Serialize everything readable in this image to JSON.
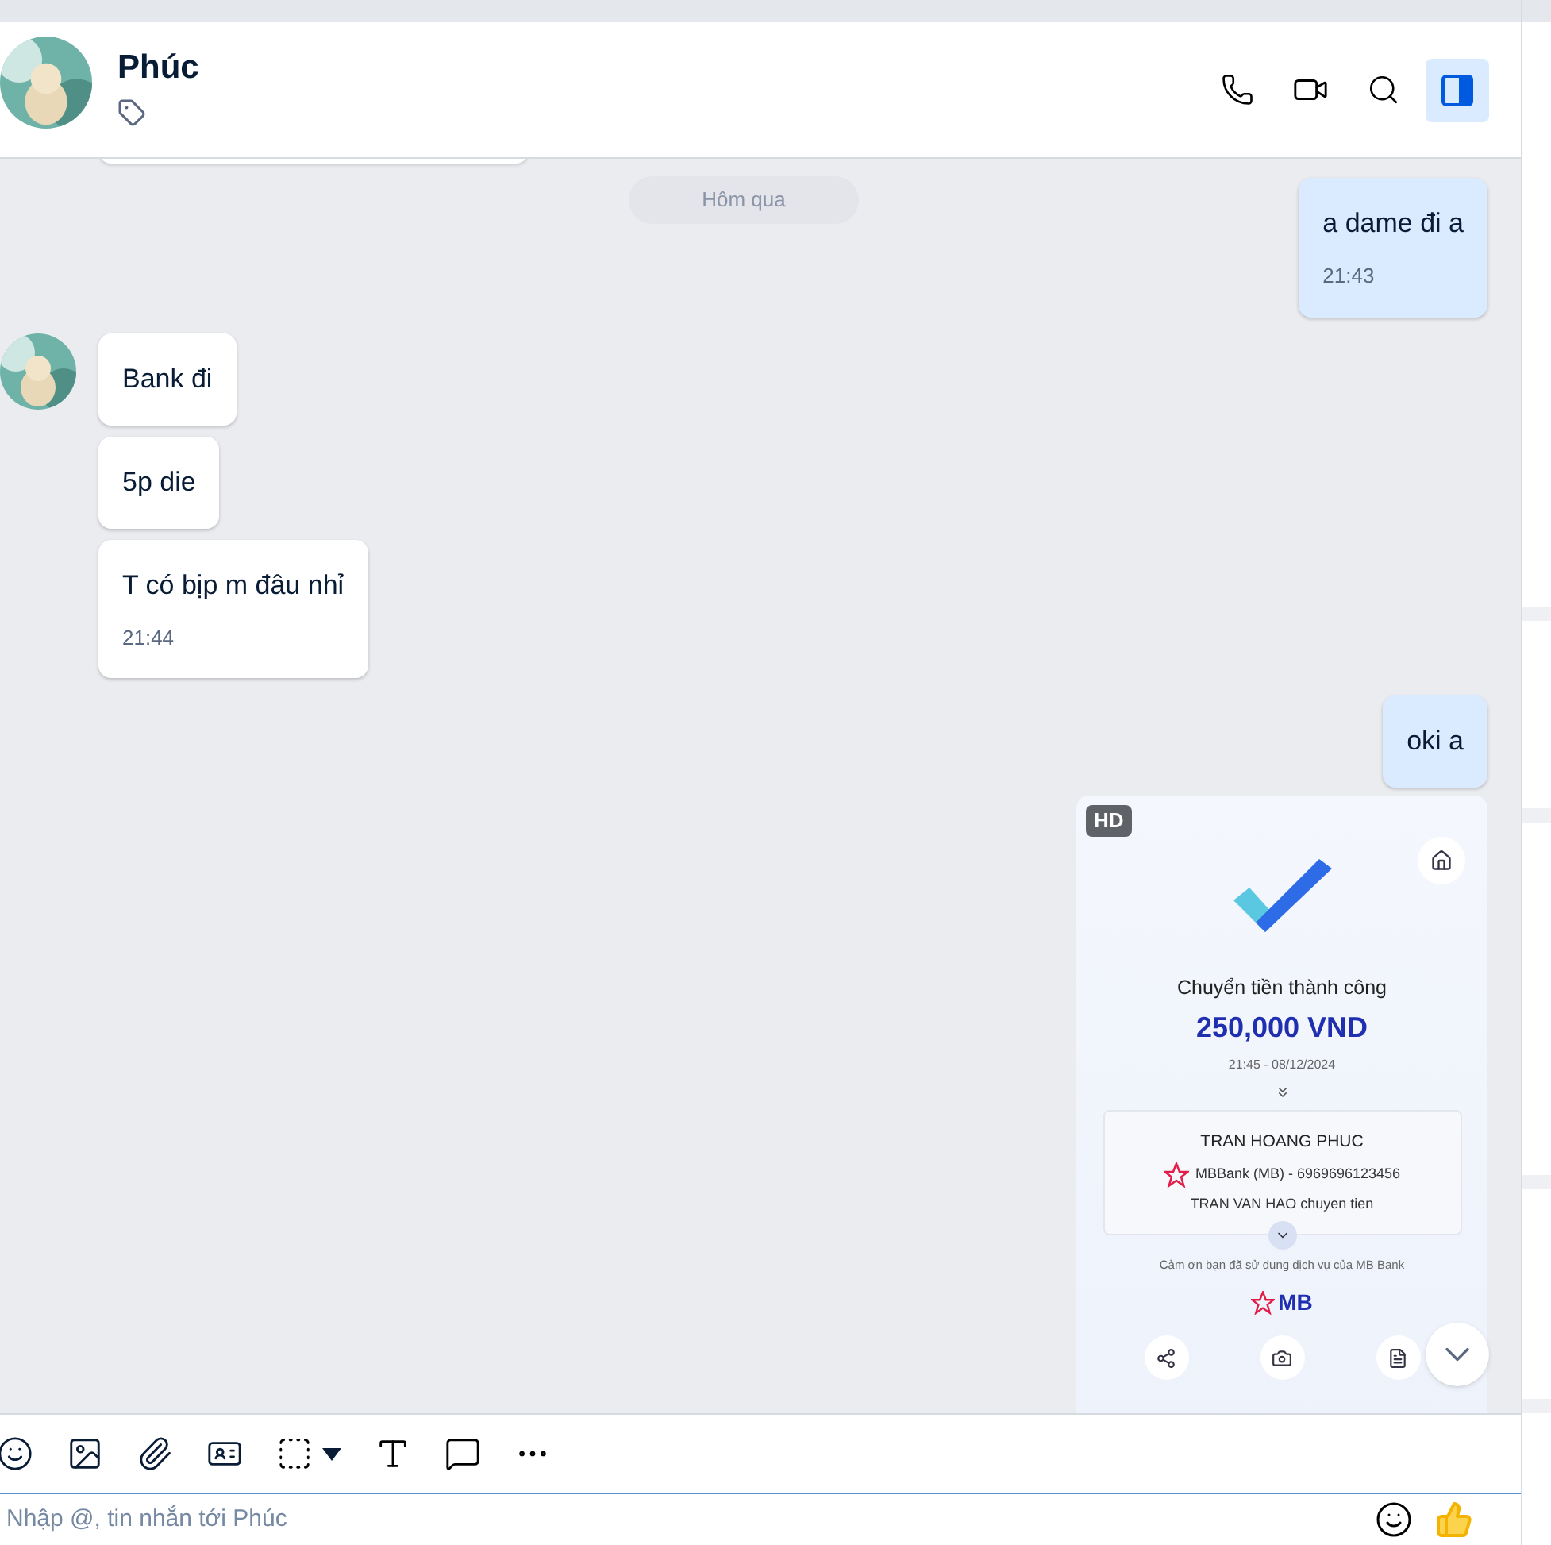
{
  "contact": {
    "name": "Phúc"
  },
  "panel_open": true,
  "date_divider": "Hôm qua",
  "messages": [
    {
      "kind": "sent",
      "text": "a dame đi a",
      "time": "21:43"
    },
    {
      "kind": "received",
      "avatar": true,
      "text": "Bank đi"
    },
    {
      "kind": "received",
      "avatar": false,
      "text": "5p die"
    },
    {
      "kind": "received",
      "avatar": false,
      "text": "T có bịp m đâu nhỉ",
      "time": "21:44"
    },
    {
      "kind": "sent",
      "text": "oki a"
    }
  ],
  "receipt": {
    "badge": "HD",
    "title": "Chuyển tiền thành công",
    "amount": "250,000 VND",
    "datetime": "21:45 - 08/12/2024",
    "recipient": "TRAN HOANG PHUC",
    "bank_account": "MBBank (MB) - 6969696123456",
    "note": "TRAN VAN HAO chuyen tien",
    "thanks": "Cảm ơn bạn đã sử dụng dịch vụ của MB Bank",
    "brand": "MB"
  },
  "composer": {
    "placeholder": "Nhập @, tin nhắn tới Phúc"
  }
}
